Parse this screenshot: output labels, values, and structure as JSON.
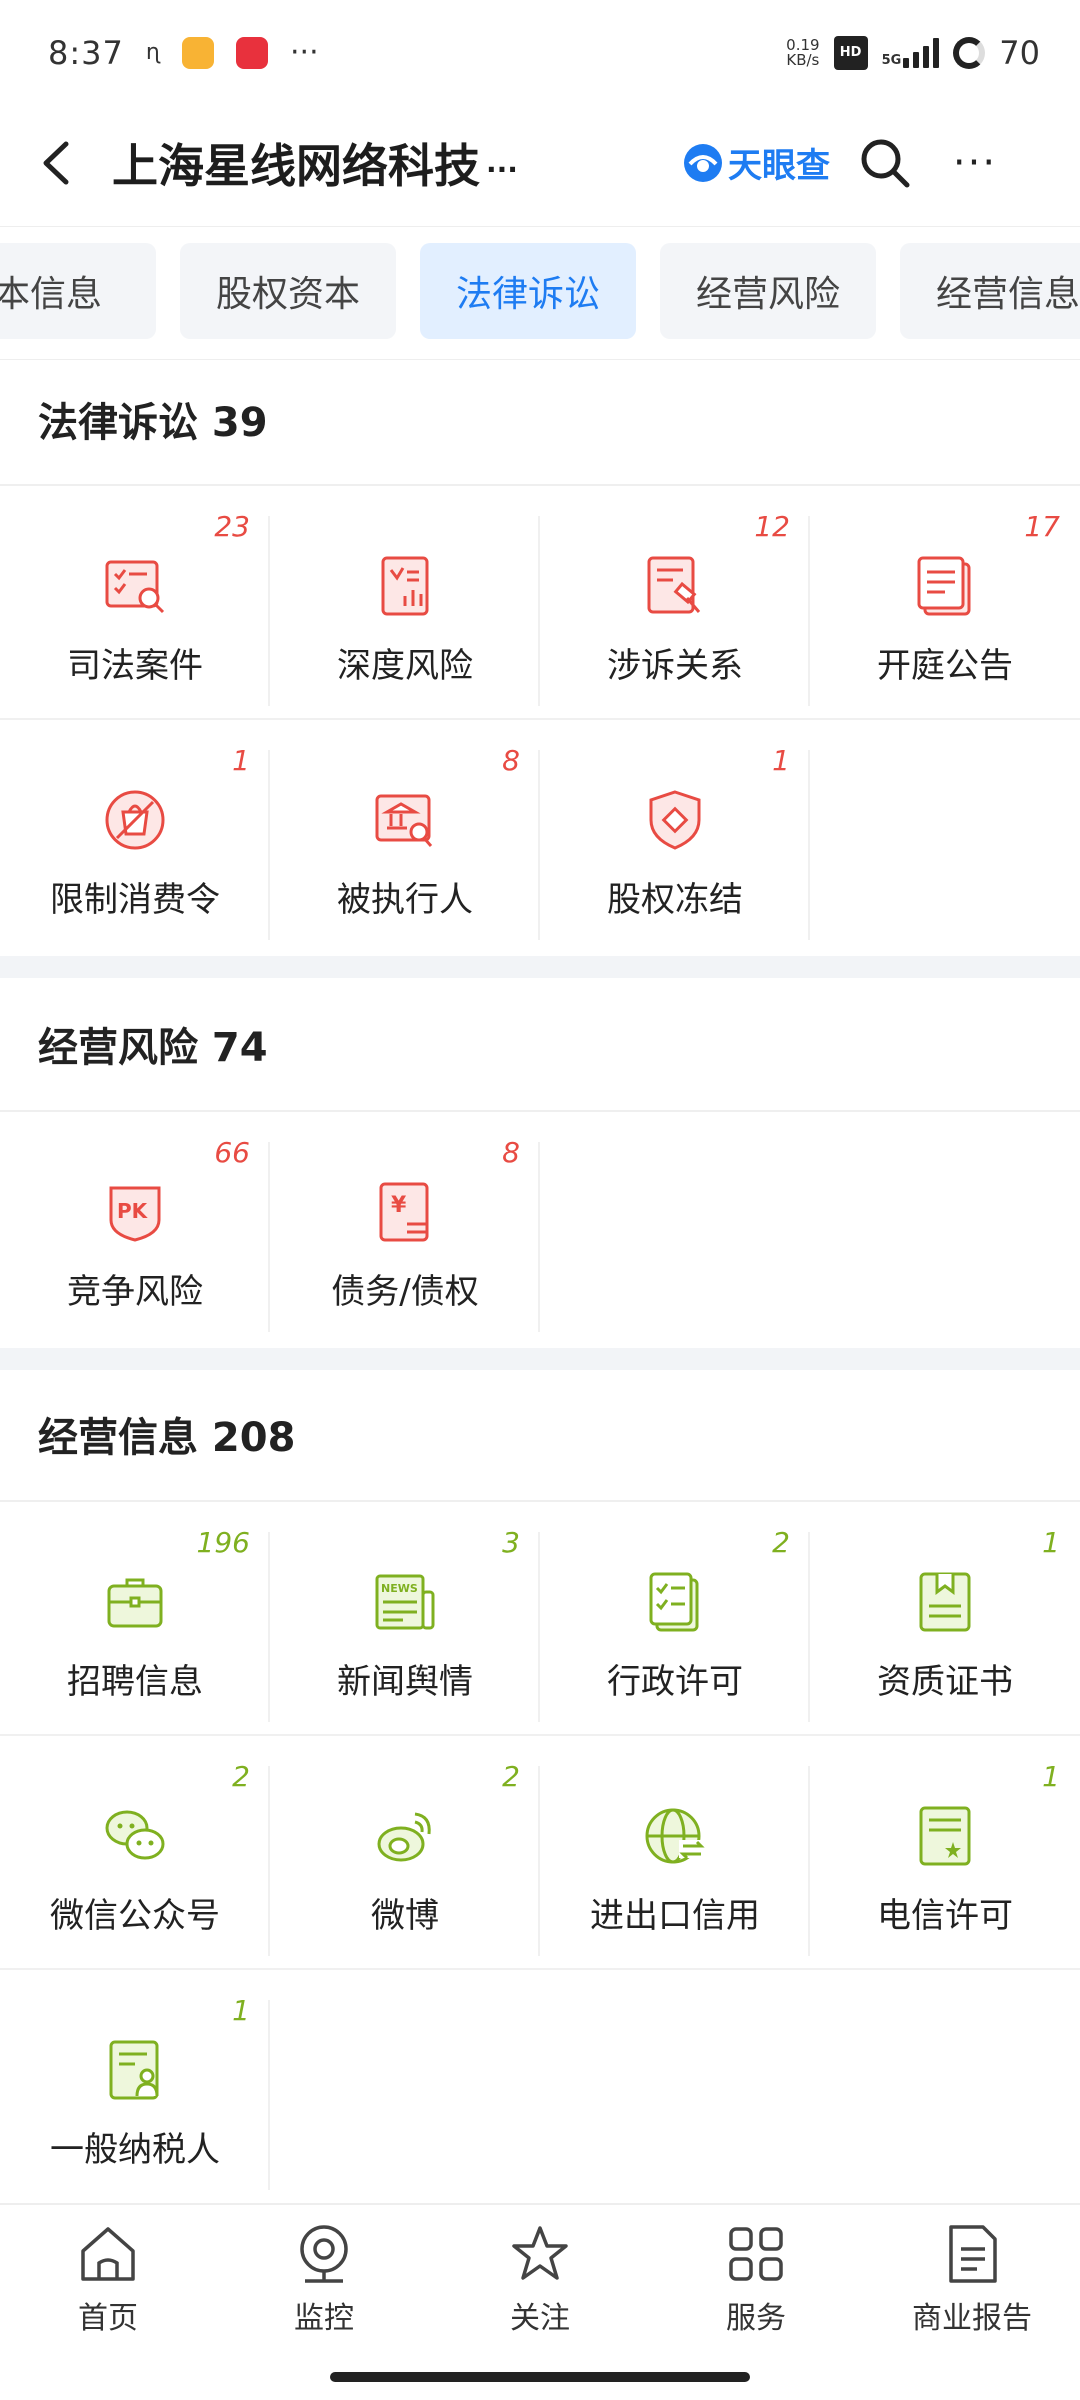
{
  "status_bar": {
    "time": "8:37",
    "net_speed": "0.19",
    "net_unit": "KB/s",
    "signal_label": "5G",
    "battery": "70",
    "more": "···"
  },
  "header": {
    "title": "上海星线网络科技",
    "title_more": "···",
    "brand_name": "天眼查",
    "more": "···"
  },
  "tabs": [
    {
      "label": "本信息"
    },
    {
      "label": "股权资本"
    },
    {
      "label": "法律诉讼",
      "active": true
    },
    {
      "label": "经营风险"
    },
    {
      "label": "经营信息"
    }
  ],
  "sections": {
    "legal": {
      "title": "法律诉讼 39",
      "items": [
        {
          "label": "司法案件",
          "count": "23",
          "icon": "judicial-case-icon"
        },
        {
          "label": "深度风险",
          "count": "",
          "icon": "deep-risk-icon"
        },
        {
          "label": "涉诉关系",
          "count": "12",
          "icon": "litigation-relation-icon"
        },
        {
          "label": "开庭公告",
          "count": "17",
          "icon": "court-notice-icon"
        },
        {
          "label": "限制消费令",
          "count": "1",
          "icon": "consumption-ban-icon"
        },
        {
          "label": "被执行人",
          "count": "8",
          "icon": "executed-person-icon"
        },
        {
          "label": "股权冻结",
          "count": "1",
          "icon": "equity-freeze-icon"
        }
      ]
    },
    "risk": {
      "title": "经营风险 74",
      "items": [
        {
          "label": "竞争风险",
          "count": "66",
          "icon": "pk-icon"
        },
        {
          "label": "债务/债权",
          "count": "8",
          "icon": "debt-icon"
        }
      ]
    },
    "info": {
      "title": "经营信息 208",
      "items": [
        {
          "label": "招聘信息",
          "count": "196",
          "icon": "briefcase-icon"
        },
        {
          "label": "新闻舆情",
          "count": "3",
          "icon": "news-icon"
        },
        {
          "label": "行政许可",
          "count": "2",
          "icon": "license-checklist-icon"
        },
        {
          "label": "资质证书",
          "count": "1",
          "icon": "certificate-icon"
        },
        {
          "label": "微信公众号",
          "count": "2",
          "icon": "wechat-icon"
        },
        {
          "label": "微博",
          "count": "2",
          "icon": "weibo-icon"
        },
        {
          "label": "进出口信用",
          "count": "",
          "icon": "globe-trade-icon"
        },
        {
          "label": "电信许可",
          "count": "1",
          "icon": "telecom-license-icon"
        },
        {
          "label": "一般纳税人",
          "count": "1",
          "icon": "taxpayer-icon"
        }
      ]
    }
  },
  "bottom_nav": [
    {
      "label": "首页",
      "icon": "home-icon"
    },
    {
      "label": "监控",
      "icon": "monitor-icon"
    },
    {
      "label": "关注",
      "icon": "star-icon"
    },
    {
      "label": "服务",
      "icon": "grid-icon"
    },
    {
      "label": "商业报告",
      "icon": "report-icon"
    }
  ],
  "colors": {
    "accent": "#1e7cf2",
    "legal_red": "#e84b43",
    "info_green": "#7fb020"
  }
}
